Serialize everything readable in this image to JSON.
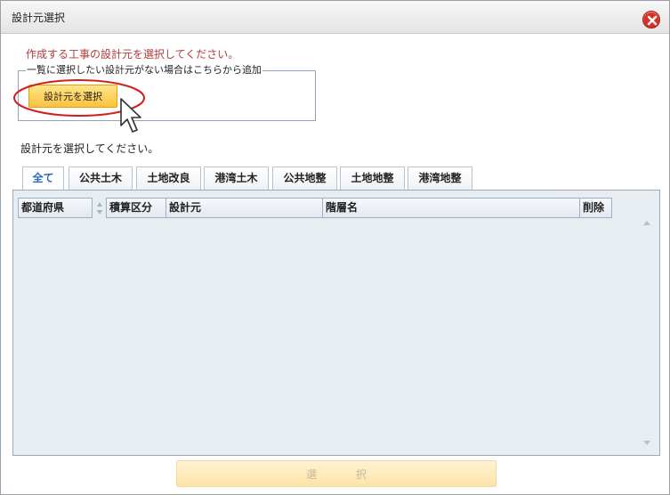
{
  "dialog": {
    "title": "設計元選択",
    "close_icon": "close-icon"
  },
  "instruction": "作成する工事の設計元を選択してください。",
  "add_group": {
    "legend": "一覧に選択したい設計元がない場合はこちらから追加",
    "button_label": "設計元を選択"
  },
  "subtext": "設計元を選択してください。",
  "tabs": [
    {
      "label": "全て",
      "active": true
    },
    {
      "label": "公共土木"
    },
    {
      "label": "土地改良"
    },
    {
      "label": "港湾土木"
    },
    {
      "label": "公共地整"
    },
    {
      "label": "土地地整"
    },
    {
      "label": "港湾地整"
    }
  ],
  "pref_column": {
    "header": "都道府県"
  },
  "table": {
    "columns": [
      "積算区分",
      "設計元",
      "階層名",
      "削除"
    ],
    "rows": []
  },
  "footer": {
    "confirm_label": "選 択"
  },
  "colors": {
    "accent_button": "#fcc23e",
    "instruction_text": "#b23b3b",
    "active_tab_text": "#2a67b1",
    "highlight": "#d01f1f"
  }
}
